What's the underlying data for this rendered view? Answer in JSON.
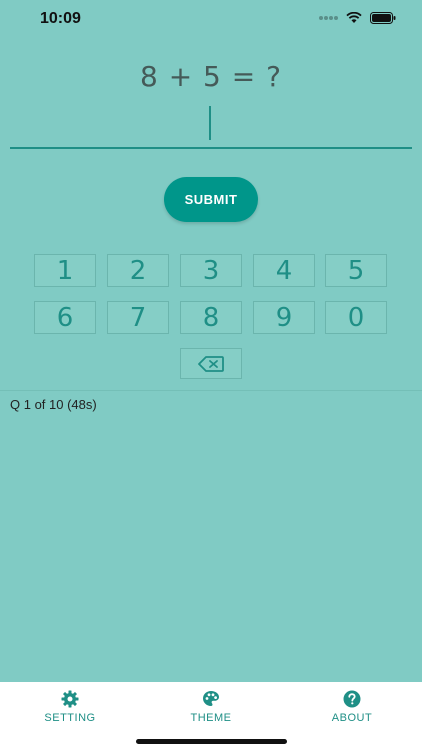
{
  "status_bar": {
    "time": "10:09",
    "icons": [
      "signal-dots-icon",
      "wifi-icon",
      "battery-icon"
    ]
  },
  "quiz": {
    "question": "8 + 5 = ?",
    "answer_value": ""
  },
  "submit_label": "SUBMIT",
  "keypad": {
    "keys": [
      "1",
      "2",
      "3",
      "4",
      "5",
      "6",
      "7",
      "8",
      "9",
      "0"
    ],
    "backspace_icon": "backspace-icon"
  },
  "progress": "Q 1 of 10 (48s)",
  "bottom_nav": {
    "items": [
      {
        "label": "SETTING",
        "icon": "gear-icon"
      },
      {
        "label": "THEME",
        "icon": "palette-icon"
      },
      {
        "label": "ABOUT",
        "icon": "help-circle-icon"
      }
    ]
  },
  "colors": {
    "background": "#80cbc4",
    "accent": "#00968a",
    "accent_text": "#1f8f86",
    "nav_background": "#ffffff"
  }
}
